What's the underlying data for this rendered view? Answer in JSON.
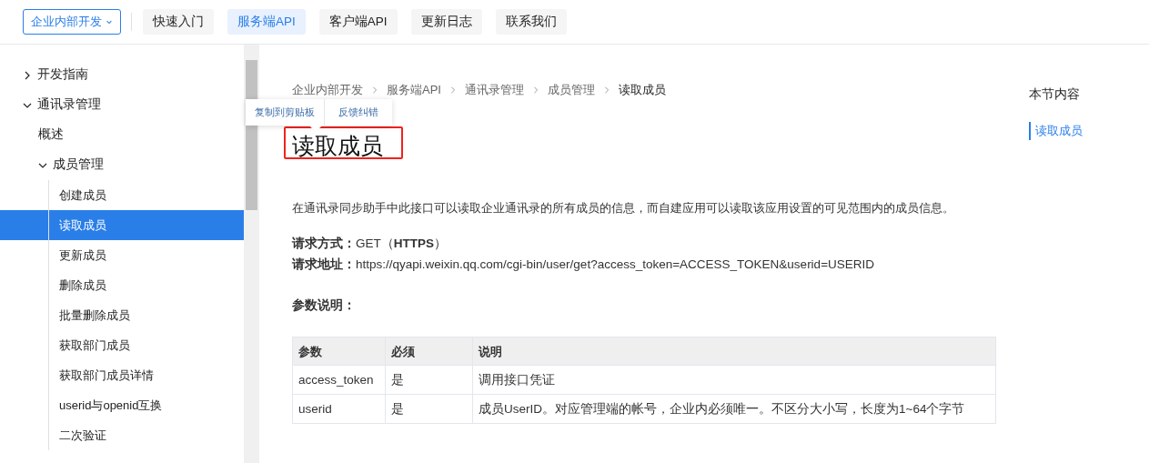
{
  "top_nav": {
    "dropdown": {
      "label": "企业内部开发"
    },
    "links": [
      {
        "label": "快速入门",
        "selected": false
      },
      {
        "label": "服务端API",
        "selected": true
      },
      {
        "label": "客户端API",
        "selected": false
      },
      {
        "label": "更新日志",
        "selected": false
      },
      {
        "label": "联系我们",
        "selected": false
      }
    ]
  },
  "sidebar": {
    "items": [
      {
        "label": "开发指南",
        "expanded": false,
        "selected": false
      },
      {
        "label": "通讯录管理",
        "expanded": true,
        "selected": false,
        "children": [
          {
            "label": "概述",
            "selected": false
          },
          {
            "label": "成员管理",
            "expanded": true,
            "selected": false,
            "children": [
              {
                "label": "创建成员",
                "selected": false
              },
              {
                "label": "读取成员",
                "selected": true
              },
              {
                "label": "更新成员",
                "selected": false
              },
              {
                "label": "删除成员",
                "selected": false
              },
              {
                "label": "批量删除成员",
                "selected": false
              },
              {
                "label": "获取部门成员",
                "selected": false
              },
              {
                "label": "获取部门成员详情",
                "selected": false
              },
              {
                "label": "userid与openid互换",
                "selected": false
              },
              {
                "label": "二次验证",
                "selected": false
              }
            ]
          }
        ]
      }
    ]
  },
  "popover": {
    "actions": [
      "复制到剪贴板",
      "反馈纠错"
    ]
  },
  "breadcrumb": [
    "企业内部开发",
    "服务端API",
    "通讯录管理",
    "成员管理",
    "读取成员"
  ],
  "title": {
    "text": "读取成员",
    "highlighted": true
  },
  "description": "在通讯录同步助手中此接口可以读取企业通讯录的所有成员的信息，而自建应用可以读取该应用设置的可见范围内的成员信息。",
  "request": [
    {
      "label": "请求方式：",
      "value": "GET（**HTTPS**）"
    },
    {
      "label": "请求地址：",
      "value": "https://qyapi.weixin.qq.com/cgi-bin/user/get?access_token=ACCESS_TOKEN&userid=USERID"
    }
  ],
  "params_heading": "参数说明：",
  "table": {
    "columns": [
      "参数",
      "必须",
      "说明"
    ],
    "rows": [
      [
        "access_token",
        "是",
        "调用接口凭证"
      ],
      [
        "userid",
        "是",
        "成员UserID。对应管理端的帐号，企业内必须唯一。不区分大小写，长度为1~64个字节"
      ]
    ]
  },
  "toc": {
    "title": "本节内容",
    "items": [
      {
        "label": "读取成员",
        "selected": true
      }
    ]
  }
}
